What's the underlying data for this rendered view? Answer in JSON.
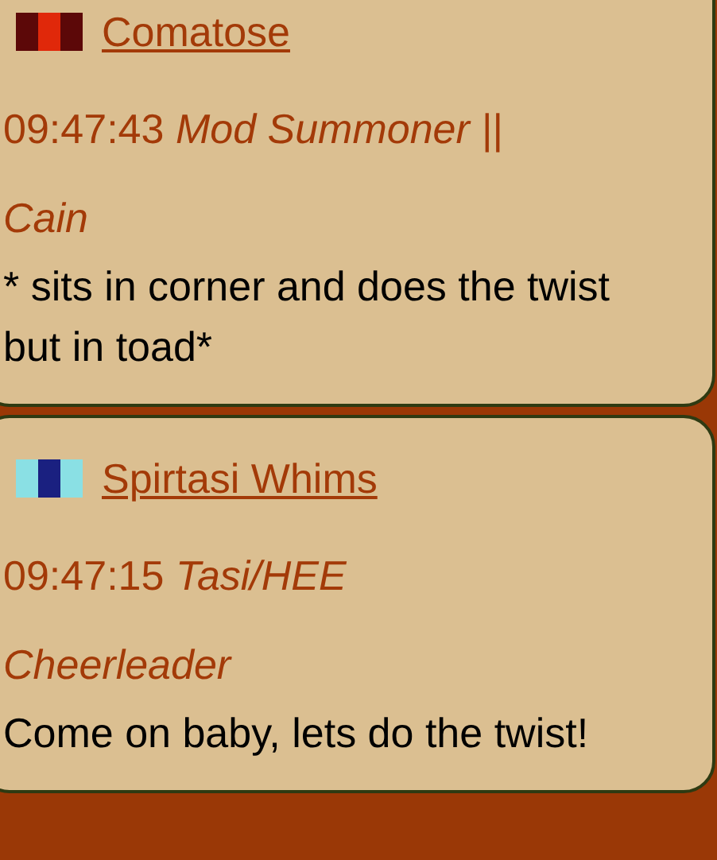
{
  "messages": [
    {
      "name": "Comatose",
      "flag": [
        {
          "color": "#5c0808"
        },
        {
          "color": "#e0280a"
        },
        {
          "color": "#5c0808"
        }
      ],
      "time": "09:47:43",
      "rank": "Mod Summoner ||",
      "role": "Cain",
      "text": "* sits in corner and does the twist but in toad*"
    },
    {
      "name": "Spirtasi Whims",
      "flag": [
        {
          "color": "#8ae0e4"
        },
        {
          "color": "#1a2080"
        },
        {
          "color": "#8ae0e4"
        }
      ],
      "time": "09:47:15",
      "rank": "Tasi/HEE",
      "role": "Cheerleader",
      "text": "Come on baby, lets do the twist!"
    }
  ]
}
